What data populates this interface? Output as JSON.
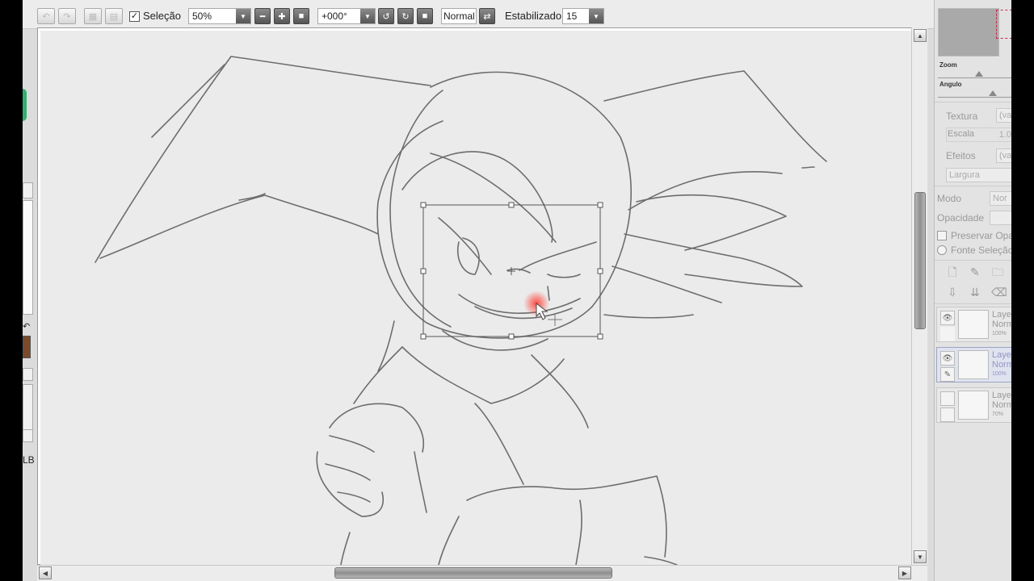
{
  "toolbar": {
    "selection_label": "Seleção",
    "selection_checked": true,
    "zoom_value": "50%",
    "angle_value": "+000°",
    "blend_value": "Normal",
    "stabilizer_label": "Estabilizador",
    "stabilizer_value": "15"
  },
  "left_strip": {
    "text": "LB"
  },
  "colors": {
    "brush_color": "#7a4a2a",
    "accent_green": "#2fb070",
    "brush_dot": "#ff3b30"
  },
  "right_panel": {
    "zoom_label": "Zoom",
    "angle_label": "Angulo",
    "texture_label": "Textura",
    "texture_value": "(va",
    "scale_label": "Escala",
    "scale_value": "1.0",
    "effects_label": "Efeitos",
    "effects_value": "(va",
    "width_label": "Largura",
    "mode_label": "Modo",
    "mode_value": "Nor",
    "opacity_label": "Opacidade",
    "preserve_label": "Preservar Opa",
    "source_label": "Fonte Seleção",
    "layers": [
      {
        "name": "Laye",
        "mode": "Norm",
        "opacity": "100%",
        "selected": false
      },
      {
        "name": "Laye",
        "mode": "Norm",
        "opacity": "100%",
        "selected": true
      },
      {
        "name": "Laye",
        "mode": "Norm",
        "opacity": "70%",
        "selected": false
      }
    ]
  }
}
